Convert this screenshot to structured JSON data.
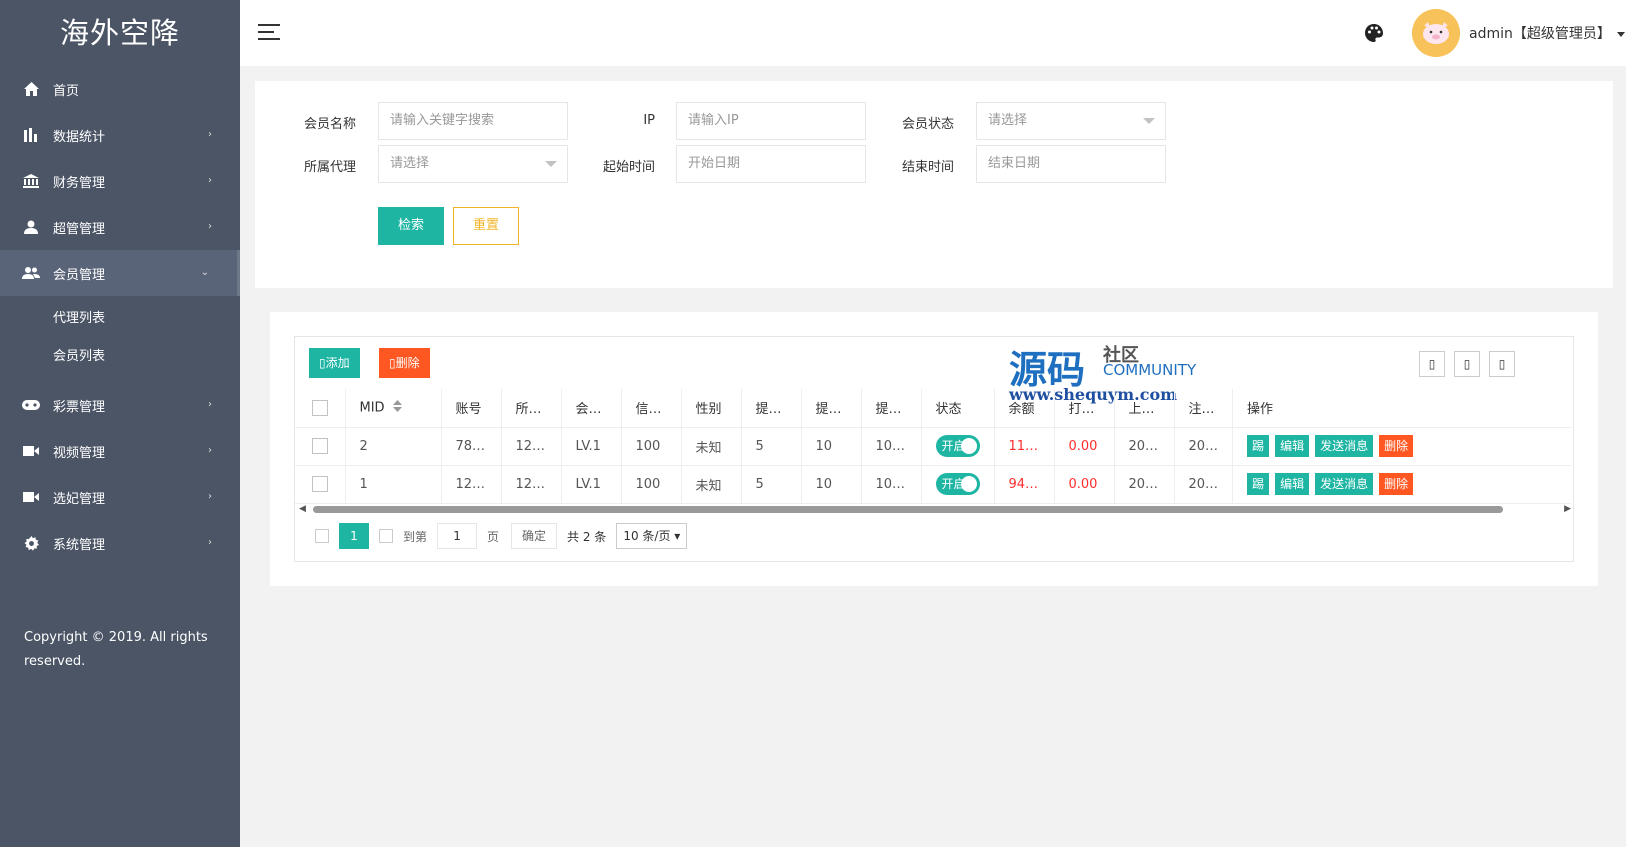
{
  "app": {
    "title": "海外空降"
  },
  "sidebar": {
    "items": [
      {
        "label": "首页",
        "icon": "home-icon"
      },
      {
        "label": "数据统计",
        "icon": "bar-chart-icon"
      },
      {
        "label": "财务管理",
        "icon": "bank-icon"
      },
      {
        "label": "超管管理",
        "icon": "user-icon"
      },
      {
        "label": "会员管理",
        "icon": "users-icon"
      },
      {
        "label": "彩票管理",
        "icon": "gamepad-icon"
      },
      {
        "label": "视频管理",
        "icon": "video-icon"
      },
      {
        "label": "选妃管理",
        "icon": "video-icon"
      },
      {
        "label": "系统管理",
        "icon": "gear-icon"
      }
    ],
    "subitems": [
      {
        "label": "代理列表"
      },
      {
        "label": "会员列表"
      }
    ],
    "copyright": "Copyright © 2019. All rights reserved."
  },
  "header": {
    "user_label": "admin【超级管理员】"
  },
  "search": {
    "member_name_label": "会员名称",
    "member_name_placeholder": "请输入关键字搜索",
    "ip_label": "IP",
    "ip_placeholder": "请输入IP",
    "status_label": "会员状态",
    "status_value": "请选择",
    "agent_label": "所属代理",
    "agent_value": "请选择",
    "start_label": "起始时间",
    "start_placeholder": "开始日期",
    "end_label": "结束时间",
    "end_placeholder": "结束日期",
    "search_button": "检索",
    "reset_button": "重置"
  },
  "toolbar": {
    "add_label": "添加",
    "delete_label": "删除"
  },
  "watermark": {
    "big": "源码",
    "small1": "社区",
    "small2": "COMMUNITY",
    "url": "www.shequym.com"
  },
  "table": {
    "headers": [
      "MID",
      "账号",
      "所…",
      "会…",
      "信…",
      "性别",
      "提…",
      "提…",
      "提…",
      "状态",
      "余额",
      "打…",
      "上…",
      "注…",
      "操作"
    ],
    "rows": [
      {
        "mid": "2",
        "account": "78…",
        "agent": "12…",
        "level": "LV.1",
        "credit": "100",
        "gender": "未知",
        "w1": "5",
        "w2": "10",
        "w3": "10…",
        "status": "开启",
        "balance": "11…",
        "bet": "0.00",
        "last": "20…",
        "reg": "20…"
      },
      {
        "mid": "1",
        "account": "12…",
        "agent": "12…",
        "level": "LV.1",
        "credit": "100",
        "gender": "未知",
        "w1": "5",
        "w2": "10",
        "w3": "10…",
        "status": "开启",
        "balance": "94…",
        "bet": "0.00",
        "last": "20…",
        "reg": "20…"
      }
    ],
    "ops": {
      "kick": "踢",
      "edit": "编辑",
      "message": "发送消息",
      "delete": "删除"
    }
  },
  "pager": {
    "current": "1",
    "goto_label": "到第",
    "page_value": "1",
    "page_unit": "页",
    "confirm": "确定",
    "total": "共 2 条",
    "per_page": "10 条/页"
  },
  "colors": {
    "sidebar": "#4b5566",
    "accent": "#1fb5a3",
    "danger": "#ff5722",
    "warning": "#f0b429"
  }
}
